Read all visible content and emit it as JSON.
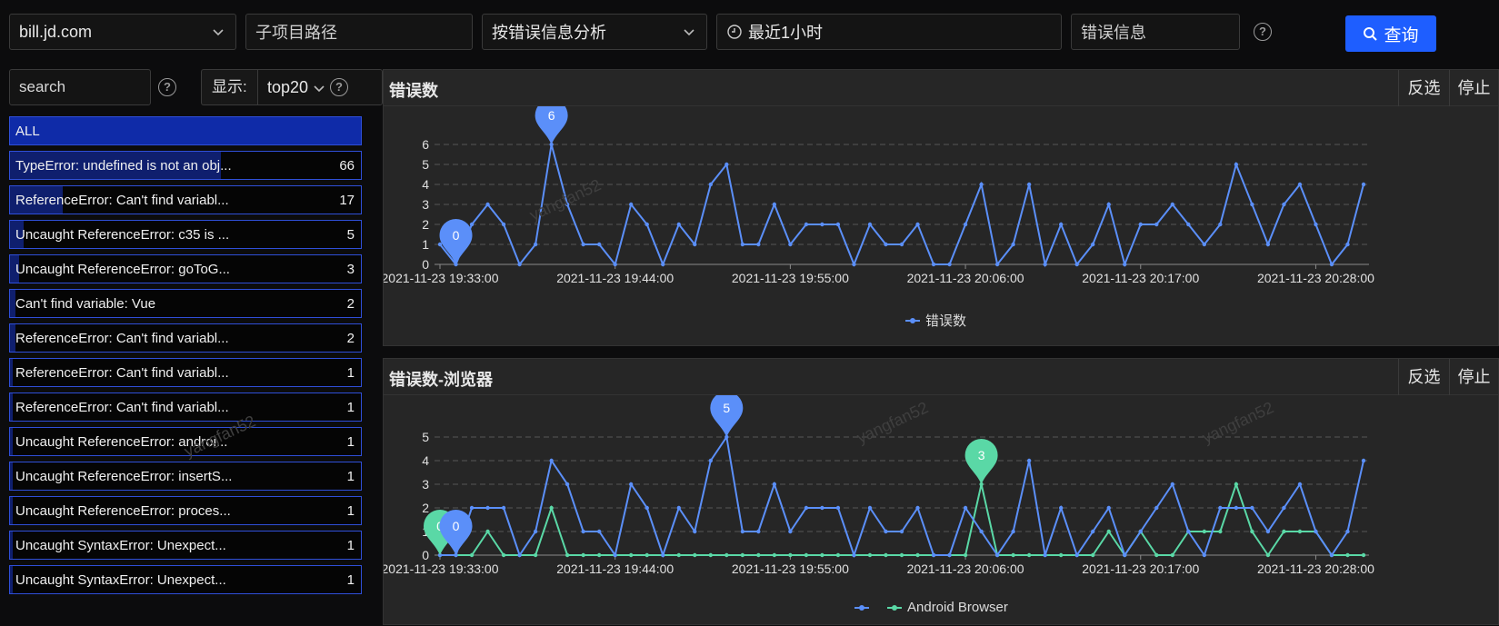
{
  "filters": {
    "domain": "bill.jd.com",
    "subpath_placeholder": "子项目路径",
    "analysis_mode": "按错误信息分析",
    "time_range": "最近1小时",
    "error_placeholder": "错误信息",
    "query_label": "查询"
  },
  "sidebar": {
    "search_placeholder": "search",
    "show_label": "显示:",
    "show_value": "top20",
    "items": [
      {
        "label": "ALL",
        "count": "",
        "fill": 1.0
      },
      {
        "label": "TypeError: undefined is not an obj...",
        "count": "66",
        "fill": 0.6
      },
      {
        "label": "ReferenceError: Can't find variabl...",
        "count": "17",
        "fill": 0.15
      },
      {
        "label": "Uncaught ReferenceError: c35 is ...",
        "count": "5",
        "fill": 0.04
      },
      {
        "label": "Uncaught ReferenceError: goToG...",
        "count": "3",
        "fill": 0.025
      },
      {
        "label": "Can't find variable: Vue",
        "count": "2",
        "fill": 0.015
      },
      {
        "label": "ReferenceError: Can't find variabl...",
        "count": "2",
        "fill": 0.015
      },
      {
        "label": "ReferenceError: Can't find variabl...",
        "count": "1",
        "fill": 0.008
      },
      {
        "label": "ReferenceError: Can't find variabl...",
        "count": "1",
        "fill": 0.008
      },
      {
        "label": "Uncaught ReferenceError: androi...",
        "count": "1",
        "fill": 0.008
      },
      {
        "label": "Uncaught ReferenceError: insertS...",
        "count": "1",
        "fill": 0.008
      },
      {
        "label": "Uncaught ReferenceError: proces...",
        "count": "1",
        "fill": 0.008
      },
      {
        "label": "Uncaught SyntaxError: Unexpect...",
        "count": "1",
        "fill": 0.008
      },
      {
        "label": "Uncaught SyntaxError: Unexpect...",
        "count": "1",
        "fill": 0.008
      }
    ]
  },
  "panels": [
    {
      "title": "错误数",
      "invert": "反选",
      "stop": "停止"
    },
    {
      "title": "错误数-浏览器",
      "invert": "反选",
      "stop": "停止"
    }
  ],
  "watermark": "yangfan52",
  "chart_data": [
    {
      "type": "line",
      "title": "错误数",
      "x_ticks": [
        "2021-11-23 19:33:00",
        "2021-11-23 19:44:00",
        "2021-11-23 19:55:00",
        "2021-11-23 20:06:00",
        "2021-11-23 20:17:00",
        "2021-11-23 20:28:00"
      ],
      "ylim": [
        0,
        6
      ],
      "y_ticks": [
        0,
        1,
        2,
        3,
        4,
        5,
        6
      ],
      "series": [
        {
          "name": "错误数",
          "color": "#5b8ff9",
          "values": [
            1,
            0,
            2,
            3,
            2,
            0,
            1,
            6,
            3,
            1,
            1,
            0,
            3,
            2,
            0,
            2,
            1,
            4,
            5,
            1,
            1,
            3,
            1,
            2,
            2,
            2,
            0,
            2,
            1,
            1,
            2,
            0,
            0,
            2,
            4,
            0,
            1,
            4,
            0,
            2,
            0,
            1,
            3,
            0,
            2,
            2,
            3,
            2,
            1,
            2,
            5,
            3,
            1,
            3,
            4,
            2,
            0,
            1,
            4
          ]
        }
      ],
      "markers": [
        {
          "label": "6",
          "index": 7,
          "value": 6
        },
        {
          "label": "0",
          "index": 1,
          "value": 0
        }
      ]
    },
    {
      "type": "line",
      "title": "错误数-浏览器",
      "x_ticks": [
        "2021-11-23 19:33:00",
        "2021-11-23 19:44:00",
        "2021-11-23 19:55:00",
        "2021-11-23 20:06:00",
        "2021-11-23 20:17:00",
        "2021-11-23 20:28:00"
      ],
      "ylim": [
        0,
        5
      ],
      "y_ticks": [
        0,
        1,
        2,
        3,
        4,
        5
      ],
      "series": [
        {
          "name": "",
          "color": "#5b8ff9",
          "values": [
            0,
            0,
            2,
            2,
            2,
            0,
            1,
            4,
            3,
            1,
            1,
            0,
            3,
            2,
            0,
            2,
            1,
            4,
            5,
            1,
            1,
            3,
            1,
            2,
            2,
            2,
            0,
            2,
            1,
            1,
            2,
            0,
            0,
            2,
            1,
            0,
            1,
            4,
            0,
            2,
            0,
            1,
            2,
            0,
            1,
            2,
            3,
            1,
            0,
            2,
            2,
            2,
            1,
            2,
            3,
            1,
            0,
            1,
            4
          ]
        },
        {
          "name": "Android Browser",
          "color": "#5ad8a6",
          "values": [
            0,
            0,
            0,
            1,
            0,
            0,
            0,
            2,
            0,
            0,
            0,
            0,
            0,
            0,
            0,
            0,
            0,
            0,
            0,
            0,
            0,
            0,
            0,
            0,
            0,
            0,
            0,
            0,
            0,
            0,
            0,
            0,
            0,
            0,
            3,
            0,
            0,
            0,
            0,
            0,
            0,
            0,
            1,
            0,
            1,
            0,
            0,
            1,
            1,
            1,
            3,
            1,
            0,
            1,
            1,
            1,
            0,
            0,
            0
          ]
        }
      ],
      "markers": [
        {
          "label": "5",
          "index": 18,
          "value": 5,
          "series": 0
        },
        {
          "label": "3",
          "index": 34,
          "value": 3,
          "series": 1
        },
        {
          "label": "0",
          "index": 0,
          "value": 0,
          "series": 1
        },
        {
          "label": "0",
          "index": 1,
          "value": 0,
          "series": 0
        }
      ]
    }
  ]
}
